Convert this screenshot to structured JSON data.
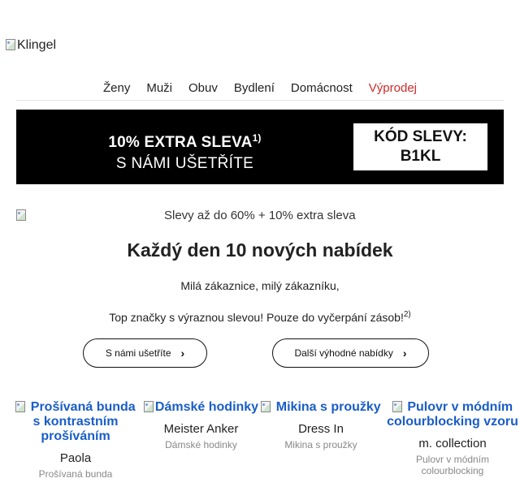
{
  "header": {
    "logo_alt": "Klingel"
  },
  "nav": {
    "items": [
      {
        "label": "Ženy"
      },
      {
        "label": "Muži"
      },
      {
        "label": "Obuv"
      },
      {
        "label": "Bydlení"
      },
      {
        "label": "Domácnost"
      },
      {
        "label": "Výprodej",
        "highlight": true
      }
    ]
  },
  "banner": {
    "line1": "10% EXTRA SLEVA",
    "line1_footnote": "1)",
    "line2": "S NÁMI UŠETŘÍTE",
    "code_label": "KÓD SLEVY:",
    "code_value": "B1KL"
  },
  "hero": {
    "image_alt": "Slevy až do 60% + 10% extra sleva",
    "headline": "Každý den 10 nových nabídek",
    "greeting": "Milá zákaznice, milý zákazníku,",
    "intro": "Top značky s výraznou slevou! Pouze do vyčerpání zásob!",
    "intro_footnote": "2)"
  },
  "cta": {
    "primary_label": "S námi ušetříte",
    "secondary_label": "Další výhodné nabídky",
    "chevron": "›"
  },
  "products": [
    {
      "title": "Prošívaná bunda s kontrastním prošíváním",
      "brand": "Paola",
      "category": "Prošívaná bunda"
    },
    {
      "title": "Dámské hodinky",
      "brand": "Meister Anker",
      "category": "Dámské hodinky"
    },
    {
      "title": "Mikina s proužky",
      "brand": "Dress In",
      "category": "Mikina s proužky"
    },
    {
      "title": "Pulovr v módním colourblocking vzoru",
      "brand": "m. collection",
      "category": "Pulovr v módním colourblocking"
    }
  ],
  "colors": {
    "accent_link": "#1a5dc8",
    "sale_red": "#d02a2a",
    "banner_bg": "#000000"
  }
}
